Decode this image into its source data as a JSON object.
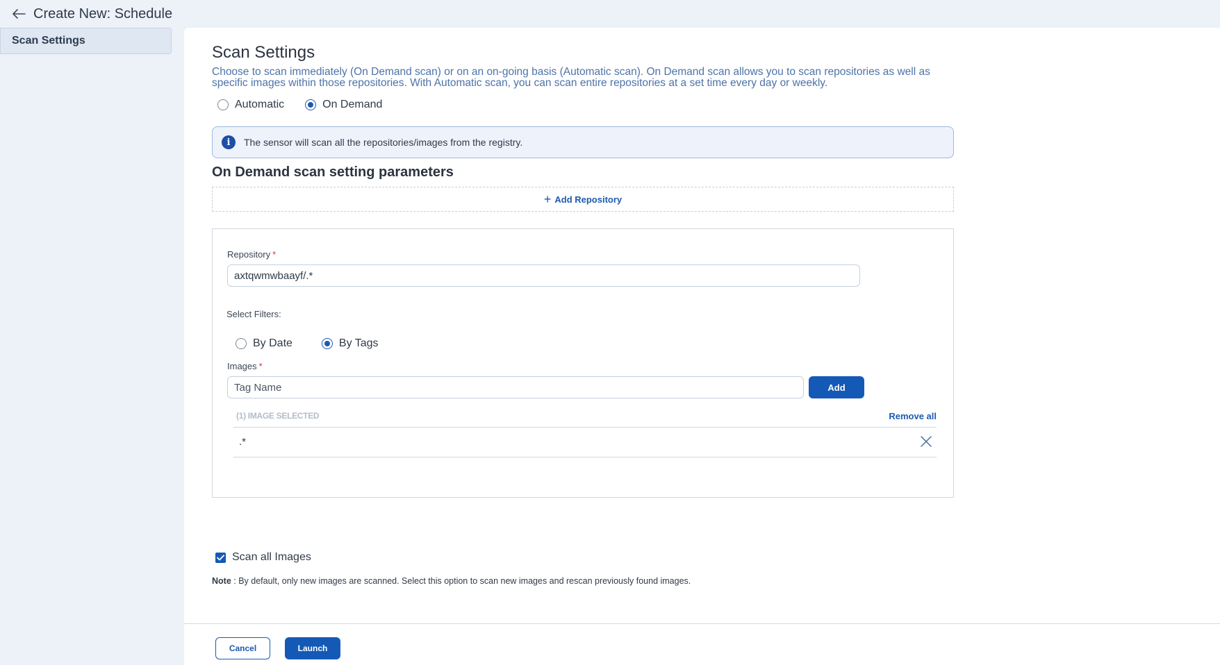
{
  "header": {
    "back_icon": "arrow-left-icon",
    "title": "Create New: Schedule"
  },
  "sidebar": {
    "items": [
      {
        "label": "Scan Settings",
        "active": true
      }
    ]
  },
  "scan_settings": {
    "title": "Scan Settings",
    "description": "Choose to scan immediately (On Demand scan) or on an on-going basis (Automatic scan). On Demand scan allows you to scan repositories as well as specific images within those repositories. With Automatic scan, you can scan entire repositories at a set time every day or weekly.",
    "mode_options": [
      {
        "label": "Automatic",
        "selected": false
      },
      {
        "label": "On Demand",
        "selected": true
      }
    ],
    "info_icon": "info-icon",
    "info_text": "The sensor will scan all the repositories/images from the registry.",
    "params_title": "On Demand scan setting parameters",
    "add_repository_label": "Add Repository"
  },
  "repository_card": {
    "repository_label": "Repository",
    "required_mark": "*",
    "repository_value": "axtqwmwbaayf/.*",
    "filters_label": "Select Filters:",
    "filter_options": [
      {
        "label": "By Date",
        "selected": false
      },
      {
        "label": "By Tags",
        "selected": true
      }
    ],
    "images_label": "Images",
    "tag_placeholder": "Tag Name",
    "add_button": "Add",
    "selected_count": "(1) IMAGE SELECTED",
    "remove_all": "Remove all",
    "selected_images": [
      ".*"
    ],
    "remove_icon": "close-icon"
  },
  "scan_all": {
    "checked": true,
    "label": "Scan all Images",
    "note_label": "Note",
    "note_text": " : By default, only new images are scanned. Select this option to scan new images and rescan previously found images."
  },
  "footer": {
    "cancel_label": "Cancel",
    "launch_label": "Launch"
  },
  "colors": {
    "primary": "#1559b6",
    "page_bg": "#edf1f8",
    "description_text": "#4d73a8",
    "required": "#d23a3a"
  }
}
